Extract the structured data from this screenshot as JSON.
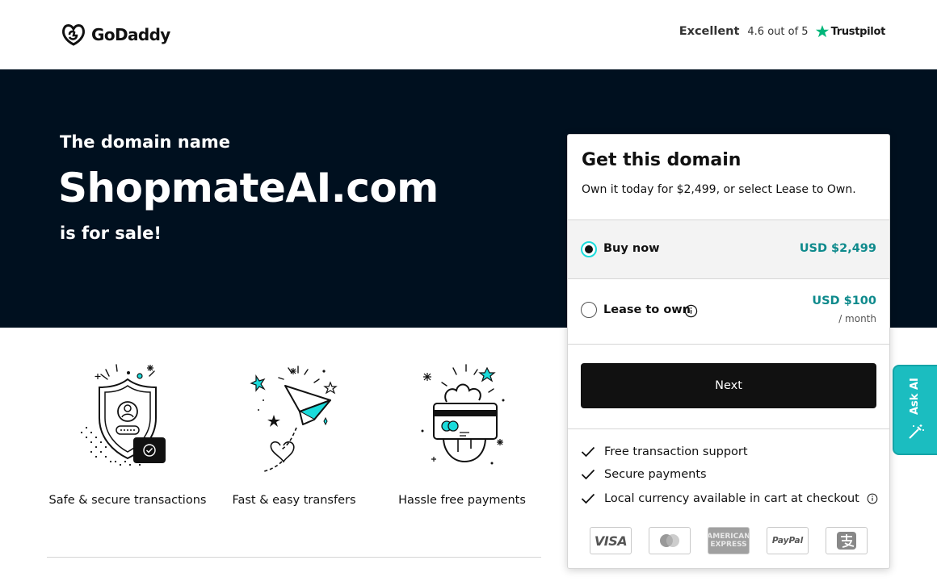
{
  "header": {
    "logo_text": "GoDaddy",
    "trustpilot": {
      "rating_word": "Excellent",
      "score": "4.6 out of 5",
      "brand": "Trustpilot"
    }
  },
  "hero": {
    "pre_title": "The domain name",
    "domain": "ShopmateAI.com",
    "post_title": "is for sale!"
  },
  "features": [
    {
      "label": "Safe & secure transactions",
      "icon": "shield-icon"
    },
    {
      "label": "Fast & easy transfers",
      "icon": "paper-plane-icon"
    },
    {
      "label": "Hassle free payments",
      "icon": "hand-card-icon"
    }
  ],
  "card": {
    "title": "Get this domain",
    "subtitle": "Own it today for $2,499, or select Lease to Own.",
    "options": {
      "buy": {
        "label": "Buy now",
        "price": "USD $2,499",
        "selected": true
      },
      "lease": {
        "label": "Lease to own",
        "price": "USD $100",
        "unit": "/ month",
        "selected": false
      }
    },
    "next_label": "Next",
    "benefits": [
      "Free transaction support",
      "Secure payments",
      "Local currency available in cart at checkout"
    ],
    "payment_methods": [
      "VISA",
      "Mastercard",
      "AMERICAN EXPRESS",
      "PayPal",
      "Alipay"
    ]
  },
  "ask_ai": {
    "label": "Ask AI"
  },
  "colors": {
    "hero_bg": "#00101f",
    "teal_price": "#0e8a8c",
    "accent_teal": "#1bdbdb",
    "ask_ai_bg": "#1bbdc0"
  }
}
